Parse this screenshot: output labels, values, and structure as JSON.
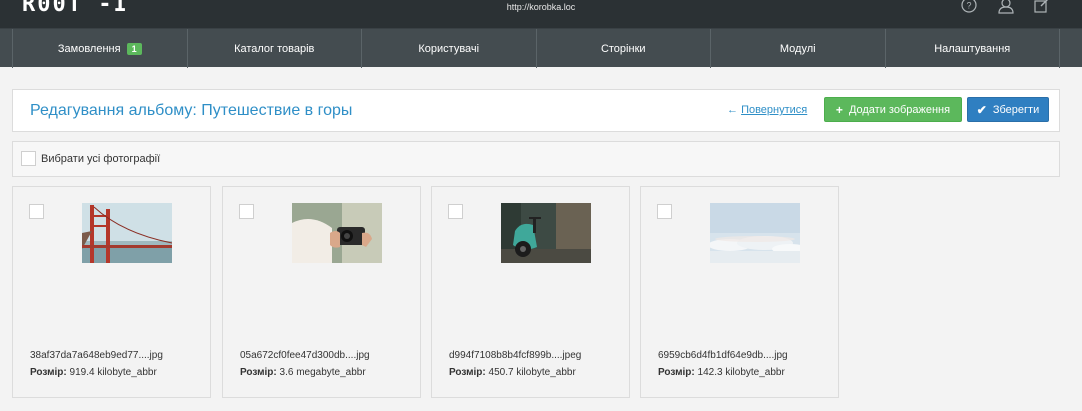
{
  "app": {
    "logo": "R00T -I",
    "url": "http://korobka.loc"
  },
  "top_icons": [
    "help-icon",
    "user-icon",
    "external-edit-icon"
  ],
  "nav": [
    {
      "label": "Замовлення",
      "badge": "1"
    },
    {
      "label": "Каталог товарів"
    },
    {
      "label": "Користувачі"
    },
    {
      "label": "Сторінки"
    },
    {
      "label": "Модулі"
    },
    {
      "label": "Налаштування"
    }
  ],
  "header": {
    "title": "Редагування альбому: Путешествие в горы",
    "back_arrow": "←",
    "back_label": "Повернутися",
    "add_icon": "+",
    "add_label": "Додати зображення",
    "save_icon": "✔",
    "save_label": "Зберегти"
  },
  "select_all_label": "Вибрати усі фотографії",
  "size_label": "Розмір:",
  "photos": [
    {
      "name": "38af37da7a648eb9ed77....jpg",
      "size": "919.4 kilobyte_abbr",
      "thumb": "golden-gate-bridge"
    },
    {
      "name": "05a672cf0fee47d300db....jpg",
      "size": "3.6 megabyte_abbr",
      "thumb": "camera-hands"
    },
    {
      "name": "d994f7108b8b4fcf899b....jpeg",
      "size": "450.7 kilobyte_abbr",
      "thumb": "green-scooter"
    },
    {
      "name": "6959cb6d4fb1df64e9db....jpg",
      "size": "142.3 kilobyte_abbr",
      "thumb": "clouds-sky"
    }
  ],
  "colors": {
    "accent": "#2f8fc7",
    "success": "#5cb85c",
    "primary": "#2f7fc1",
    "topbar": "#2b3134",
    "nav": "#444c50"
  }
}
